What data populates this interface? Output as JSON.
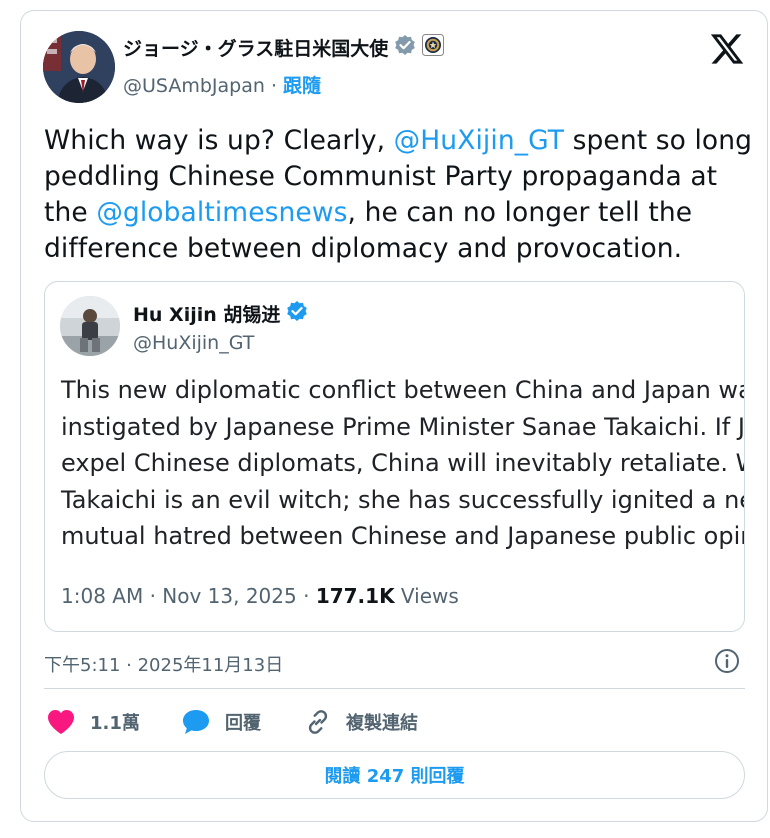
{
  "author": {
    "display_name": "ジョージ・グラス駐日米国大使",
    "handle": "@USAmbJapan",
    "separator": "·",
    "follow_label": "跟隨"
  },
  "tweet": {
    "text_1": "Which way is up? Clearly, ",
    "mention_1": "@HuXijin_GT",
    "text_2": " spent so long peddling Chinese Communist Party propaganda at the ",
    "mention_2": "@globaltimesnews",
    "text_3": ", he can no longer tell the difference between diplomacy and provocation.",
    "timestamp": "下午5:11 · 2025年11月13日"
  },
  "quoted_tweet": {
    "display_name": "Hu Xijin 胡锡进",
    "handle": "@HuXijin_GT",
    "lines": [
      "This new diplomatic conflict between China and Japan was",
      "instigated by Japanese Prime Minister Sanae Takaichi. If Ja",
      "expel Chinese diplomats, China will inevitably retaliate. We",
      "Takaichi is an evil witch; she has successfully ignited a new",
      "mutual hatred between Chinese and Japanese public opin"
    ],
    "time": "1:08 AM · Nov 13, 2025 · ",
    "views_count": "177.1K",
    "views_label": " Views"
  },
  "actions": {
    "like_count": "1.1萬",
    "reply_label": "回覆",
    "copy_link_label": "複製連結",
    "read_replies_label": "閱讀 247 則回覆"
  },
  "colors": {
    "accent": "#1d9bf0",
    "like": "#f91880",
    "muted_text": "#536471",
    "border": "#cfd9de"
  },
  "icons": [
    "x-logo-icon",
    "verified-gray-icon",
    "government-seal-icon",
    "verified-blue-icon",
    "info-icon",
    "heart-icon",
    "reply-bubble-icon",
    "link-icon"
  ]
}
